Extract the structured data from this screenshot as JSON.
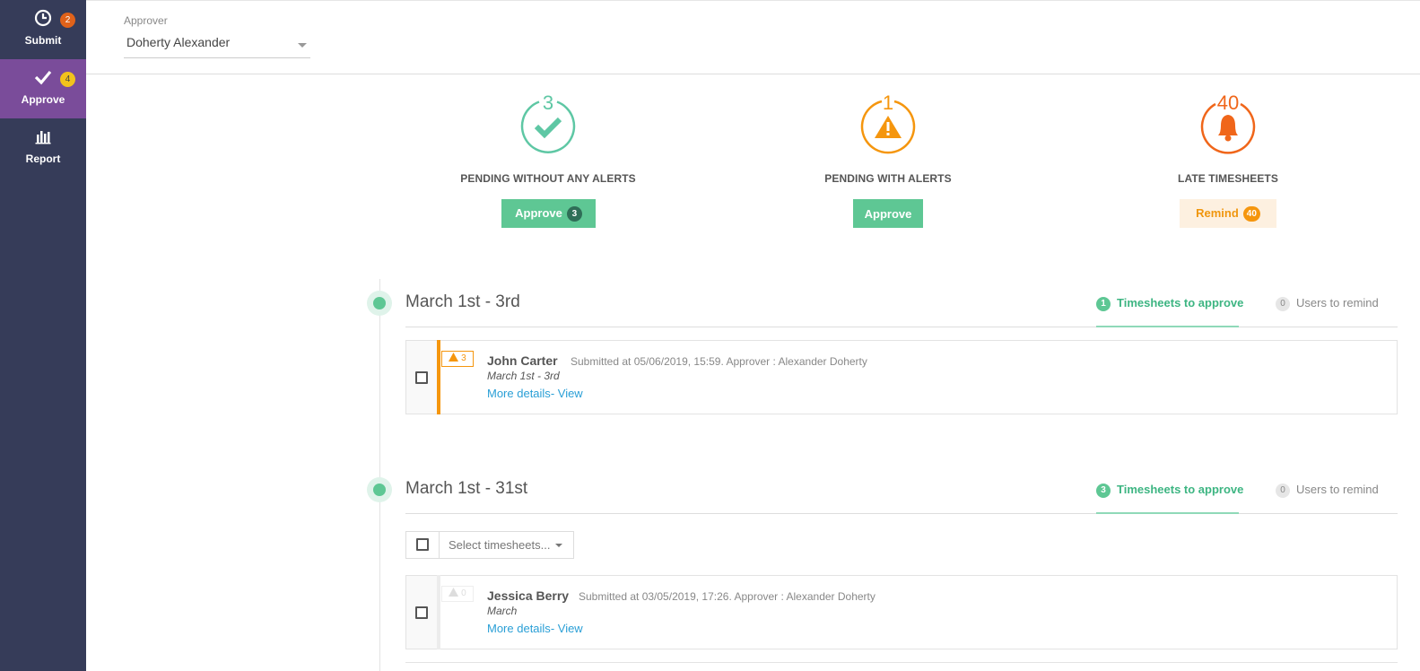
{
  "sidebar": {
    "items": [
      {
        "label": "Submit",
        "icon": "clock-icon",
        "badge": "2",
        "badge_color": "#e0621a"
      },
      {
        "label": "Approve",
        "icon": "check-icon",
        "badge": "4",
        "badge_color": "#f2c21c"
      },
      {
        "label": "Report",
        "icon": "bar-chart-icon"
      }
    ]
  },
  "header": {
    "approver_label": "Approver",
    "approver_value": "Doherty Alexander"
  },
  "summary": {
    "pending_no_alerts": {
      "count": "3",
      "title": "PENDING WITHOUT ANY ALERTS",
      "button_label": "Approve",
      "button_count": "3",
      "color": "#5ec7a4"
    },
    "pending_alerts": {
      "count": "1",
      "title": "PENDING WITH ALERTS",
      "button_label": "Approve",
      "color": "#f5960e"
    },
    "late": {
      "count": "40",
      "title": "LATE TIMESHEETS",
      "button_label": "Remind",
      "button_count": "40",
      "color": "#f0661a"
    }
  },
  "periods": [
    {
      "title": "March 1st - 3rd",
      "tab_approve_count": "1",
      "tab_approve_label": "Timesheets to approve",
      "tab_remind_count": "0",
      "tab_remind_label": "Users to remind",
      "rows": [
        {
          "name": "John Carter",
          "meta": "Submitted at 05/06/2019, 15:59. Approver : Alexander Doherty",
          "period": "March 1st - 3rd",
          "alert_count": "3",
          "more": "More details",
          "view": "- View"
        }
      ]
    },
    {
      "title": "March 1st - 31st",
      "tab_approve_count": "3",
      "tab_approve_label": "Timesheets to approve",
      "tab_remind_count": "0",
      "tab_remind_label": "Users to remind",
      "bulk_select_label": "Select timesheets...",
      "rows": [
        {
          "name": "Jessica Berry",
          "meta": "Submitted at 03/05/2019, 17:26. Approver : Alexander Doherty",
          "period": "March",
          "alert_count": "0",
          "more": "More details",
          "view": "- View"
        }
      ]
    }
  ]
}
